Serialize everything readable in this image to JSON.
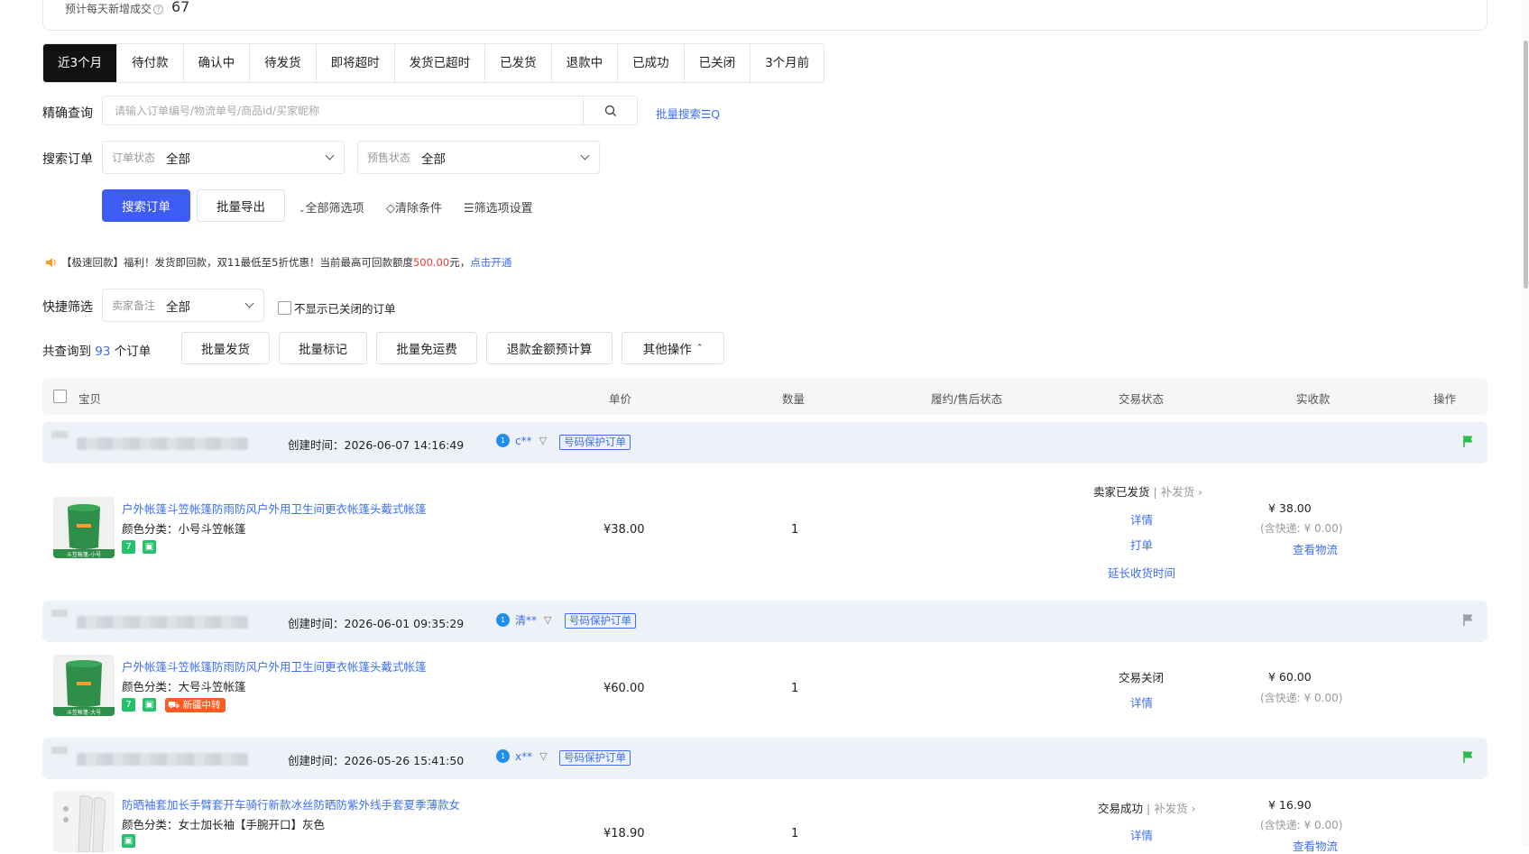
{
  "stats": {
    "label": "预计每天新增成交",
    "value": "67"
  },
  "tabs": [
    "近3个月",
    "待付款",
    "确认中",
    "待发货",
    "即将超时",
    "发货已超时",
    "已发货",
    "退款中",
    "已成功",
    "已关闭",
    "3个月前"
  ],
  "precise_search": {
    "label": "精确查询",
    "placeholder": "请输入订单编号/物流单号/商品id/买家昵称",
    "batch_label": "批量搜索"
  },
  "search_orders": {
    "label": "搜索订单",
    "order_status": {
      "label": "订单状态",
      "value": "全部"
    },
    "presale_status": {
      "label": "预售状态",
      "value": "全部"
    }
  },
  "actions": {
    "search": "搜索订单",
    "export": "批量导出",
    "all_filters": "全部筛选项",
    "clear": "清除条件",
    "filter_settings": "筛选项设置"
  },
  "notice": {
    "prefix": "【极速回款】福利！发货即回款，双11最低至5折优惠！当前最高可回款额度",
    "amount": "500.00",
    "suffix": "元，",
    "link": "点击开通"
  },
  "quick_filter": {
    "label": "快捷筛选",
    "seller_note": {
      "label": "卖家备注",
      "value": "全部"
    },
    "hide_closed": "不显示已关闭的订单"
  },
  "summary": {
    "prefix": "共查询到",
    "count": "93",
    "suffix": "个订单"
  },
  "bulk_actions": [
    "批量发货",
    "批量标记",
    "批量免运费",
    "退款金额预计算",
    "其他操作"
  ],
  "table_headers": {
    "item": "宝贝",
    "price": "单价",
    "qty": "数量",
    "fulfil": "履约/售后状态",
    "trade": "交易状态",
    "received": "实收款",
    "ops": "操作"
  },
  "orders": [
    {
      "created": "创建时间：2026-06-07 14:16:49",
      "buyer": "c**",
      "protect": "号码保护订单",
      "flag_color": "#2bbd4c",
      "title": "户外帐篷斗笠帐篷防雨防风户外用卫生间更衣帐篷头戴式帐篷",
      "sku": "颜色分类：小号斗笠帐篷",
      "thumb_caption": "斗笠帐篷-小号",
      "price": "¥38.00",
      "qty": "1",
      "status": "卖家已发货",
      "status_extra": "补发货",
      "links": [
        "详情",
        "打单",
        "延长收货时间"
      ],
      "received": "¥ 38.00",
      "shipping": "(含快递: ¥ 0.00)",
      "received_link": "查看物流"
    },
    {
      "created": "创建时间：2026-06-01 09:35:29",
      "buyer": "清**",
      "protect": "号码保护订单",
      "flag_color": "#9aa0a6",
      "title": "户外帐篷斗笠帐篷防雨防风户外用卫生间更衣帐篷头戴式帐篷",
      "sku": "颜色分类：大号斗笠帐篷",
      "thumb_caption": "斗笠帐篷-大号",
      "badge_xj": "新疆中转",
      "price": "¥60.00",
      "qty": "1",
      "status": "交易关闭",
      "links": [
        "详情"
      ],
      "received": "¥ 60.00",
      "shipping": "(含快递: ¥ 0.00)"
    },
    {
      "created": "创建时间：2026-05-26 15:41:50",
      "buyer": "x**",
      "protect": "号码保护订单",
      "flag_color": "#2bbd4c",
      "title": "防晒袖套加长手臂套开车骑行新款冰丝防晒防紫外线手套夏季薄款女",
      "sku": "颜色分类：女士加长袖【手腕开口】灰色",
      "price": "¥18.90",
      "qty": "1",
      "status": "交易成功",
      "status_extra": "补发货",
      "links": [
        "详情"
      ],
      "received": "¥ 16.90",
      "shipping": "(含快递: ¥ 0.00)",
      "received_link": "查看物流"
    }
  ]
}
